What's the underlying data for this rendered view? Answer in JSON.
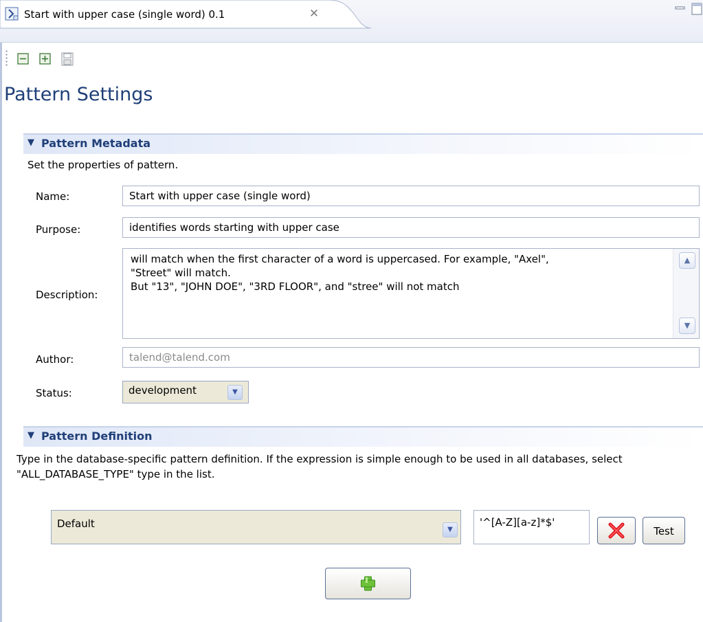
{
  "tab": {
    "title": "Start with upper case (single word) 0.1",
    "icon": "pattern-file-icon",
    "close_glyph": "✕"
  },
  "toolbar": {
    "collapse_icon": "collapse-all-icon",
    "expand_icon": "expand-all-icon",
    "save_icon": "save-icon"
  },
  "page": {
    "title": "Pattern Settings"
  },
  "metadata": {
    "title": "Pattern Metadata",
    "description": "Set the properties of pattern.",
    "name_label": "Name:",
    "name_value": "Start with upper case (single word)",
    "purpose_label": "Purpose:",
    "purpose_value": "identifies words starting with upper case",
    "description_label": "Description:",
    "description_value": "will match when the first character of a word is uppercased. For example, \"Axel\",\n\"Street\" will match.\nBut \"13\", \"JOHN DOE\", \"3RD FLOOR\", and \"stree\" will not match",
    "author_label": "Author:",
    "author_value": "talend@talend.com",
    "status_label": "Status:",
    "status_value": "development"
  },
  "definition": {
    "title": "Pattern Definition",
    "description": "Type in the database-specific pattern definition. If the expression is simple enough to be used in all databases, select \"ALL_DATABASE_TYPE\" type in the list.",
    "db_type_value": "Default",
    "regex_value": "'^[A-Z][a-z]*$'",
    "delete_icon": "delete-x-icon",
    "test_label": "Test",
    "add_icon": "add-plus-icon"
  },
  "colors": {
    "heading": "#1f3f78",
    "section_band": "#dfe7f7",
    "combo_bg": "#ece9d8",
    "delete_red": "#e0141e",
    "add_green": "#6ec23a"
  }
}
